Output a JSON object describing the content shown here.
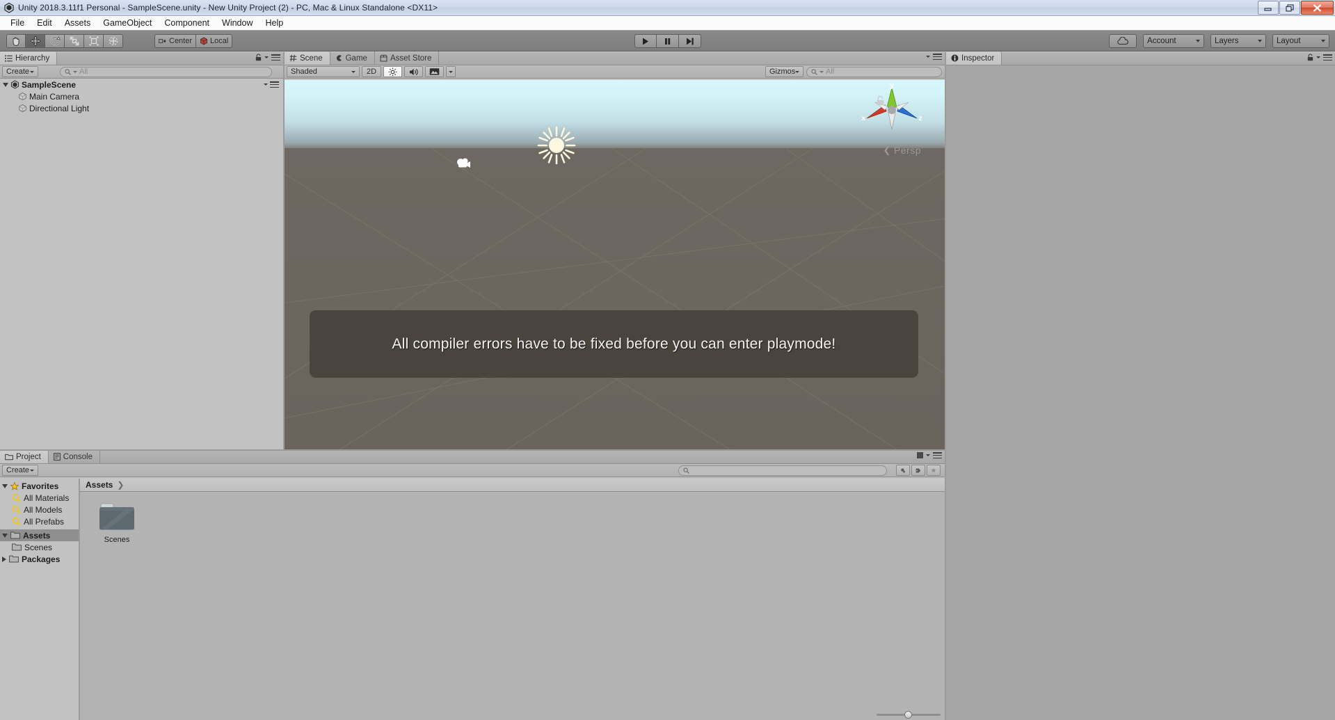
{
  "window": {
    "title": "Unity 2018.3.11f1 Personal - SampleScene.unity - New Unity Project (2) - PC, Mac & Linux Standalone <DX11>",
    "logo_icon": "unity-logo-icon",
    "minimize_icon": "minimize-icon",
    "restore_icon": "restore-icon",
    "close_icon": "close-icon"
  },
  "menubar": {
    "items": [
      "File",
      "Edit",
      "Assets",
      "GameObject",
      "Component",
      "Window",
      "Help"
    ]
  },
  "toolbar": {
    "transform_tools": [
      {
        "name": "hand-tool",
        "icon": "hand-icon",
        "active": false
      },
      {
        "name": "move-tool",
        "icon": "move-arrows-icon",
        "active": true
      },
      {
        "name": "rotate-tool",
        "icon": "rotate-icon",
        "active": false
      },
      {
        "name": "scale-tool",
        "icon": "scale-icon",
        "active": false
      },
      {
        "name": "rect-tool",
        "icon": "rect-transform-icon",
        "active": false
      },
      {
        "name": "transform-tool",
        "icon": "combined-transform-icon",
        "active": false
      }
    ],
    "pivot_mode": {
      "label": "Center",
      "icon": "pivot-center-icon"
    },
    "pivot_rotation": {
      "label": "Local",
      "icon": "local-rotation-icon"
    },
    "play_controls": [
      {
        "name": "play-button",
        "icon": "play-icon"
      },
      {
        "name": "pause-button",
        "icon": "pause-icon"
      },
      {
        "name": "step-button",
        "icon": "step-icon"
      }
    ],
    "cloud_button": {
      "icon": "cloud-icon"
    },
    "account": "Account",
    "layers": "Layers",
    "layout": "Layout"
  },
  "hierarchy": {
    "tab_label": "Hierarchy",
    "tab_icon": "hierarchy-icon",
    "create_label": "Create",
    "search_placeholder": "All",
    "search_icon": "search-icon",
    "lock_icon": "lock-icon",
    "menu_icon": "panel-menu-icon",
    "scene_name": "SampleScene",
    "scene_icon": "unity-scene-icon",
    "objects": [
      {
        "label": "Main Camera",
        "icon": "gameobject-cube-icon"
      },
      {
        "label": "Directional Light",
        "icon": "gameobject-cube-icon"
      }
    ]
  },
  "scene_panel": {
    "tabs": [
      {
        "label": "Scene",
        "icon": "scene-grid-icon",
        "active": true
      },
      {
        "label": "Game",
        "icon": "game-pacman-icon",
        "active": false
      },
      {
        "label": "Asset Store",
        "icon": "asset-store-icon",
        "active": false
      }
    ],
    "draw_mode": "Shaded",
    "view_2d": "2D",
    "lighting_icon": "sun-lighting-icon",
    "audio_icon": "audio-speaker-icon",
    "fx_icon": "image-effects-icon",
    "gizmos_label": "Gizmos",
    "gizmos_search_placeholder": "All",
    "search_icon": "search-icon",
    "menu_icon": "panel-menu-icon",
    "gizmo": {
      "x_label": "x",
      "y_label": "y",
      "z_label": "z",
      "x_color": "#cf3b2a",
      "y_color": "#7fc72a",
      "z_color": "#2c6fd6",
      "perspective_label": "Persp"
    },
    "overlay_message": "All compiler errors have to be fixed before you can enter playmode!",
    "gizmo_objects": [
      {
        "name": "camera-gizmo",
        "icon": "camera-icon"
      },
      {
        "name": "directional-light-gizmo",
        "icon": "sun-icon"
      }
    ],
    "sky_top_color": "#d6f7fb",
    "ground_color": "#6d6861"
  },
  "inspector": {
    "tab_label": "Inspector",
    "tab_icon": "info-circle-icon",
    "lock_icon": "lock-icon",
    "menu_icon": "panel-menu-icon"
  },
  "project": {
    "tabs": [
      {
        "label": "Project",
        "icon": "folder-icon",
        "active": true
      },
      {
        "label": "Console",
        "icon": "console-icon",
        "active": false
      }
    ],
    "create_label": "Create",
    "search_placeholder": "",
    "search_icon": "search-icon",
    "filter_icons": [
      "filter-by-type-icon",
      "filter-by-label-icon",
      "favorite-star-icon"
    ],
    "menu_icon": "panel-menu-icon",
    "tree": [
      {
        "label": "Favorites",
        "icon": "star-icon",
        "expanded": true,
        "depth": 0,
        "bold": true,
        "selected": false
      },
      {
        "label": "All Materials",
        "icon": "search-saved-icon",
        "depth": 1,
        "bold": false,
        "selected": false
      },
      {
        "label": "All Models",
        "icon": "search-saved-icon",
        "depth": 1,
        "bold": false,
        "selected": false
      },
      {
        "label": "All Prefabs",
        "icon": "search-saved-icon",
        "depth": 1,
        "bold": false,
        "selected": false
      },
      {
        "label": "Assets",
        "icon": "folder-icon",
        "expanded": true,
        "depth": 0,
        "bold": true,
        "selected": true
      },
      {
        "label": "Scenes",
        "icon": "folder-icon",
        "depth": 1,
        "bold": false,
        "selected": false
      },
      {
        "label": "Packages",
        "icon": "folder-icon",
        "expanded": false,
        "depth": 0,
        "bold": true,
        "selected": false
      }
    ],
    "breadcrumb": [
      "Assets"
    ],
    "breadcrumb_separator": "❯",
    "assets": [
      {
        "label": "Scenes",
        "icon": "folder-icon-large"
      }
    ],
    "zoom_slider_value": 50
  }
}
